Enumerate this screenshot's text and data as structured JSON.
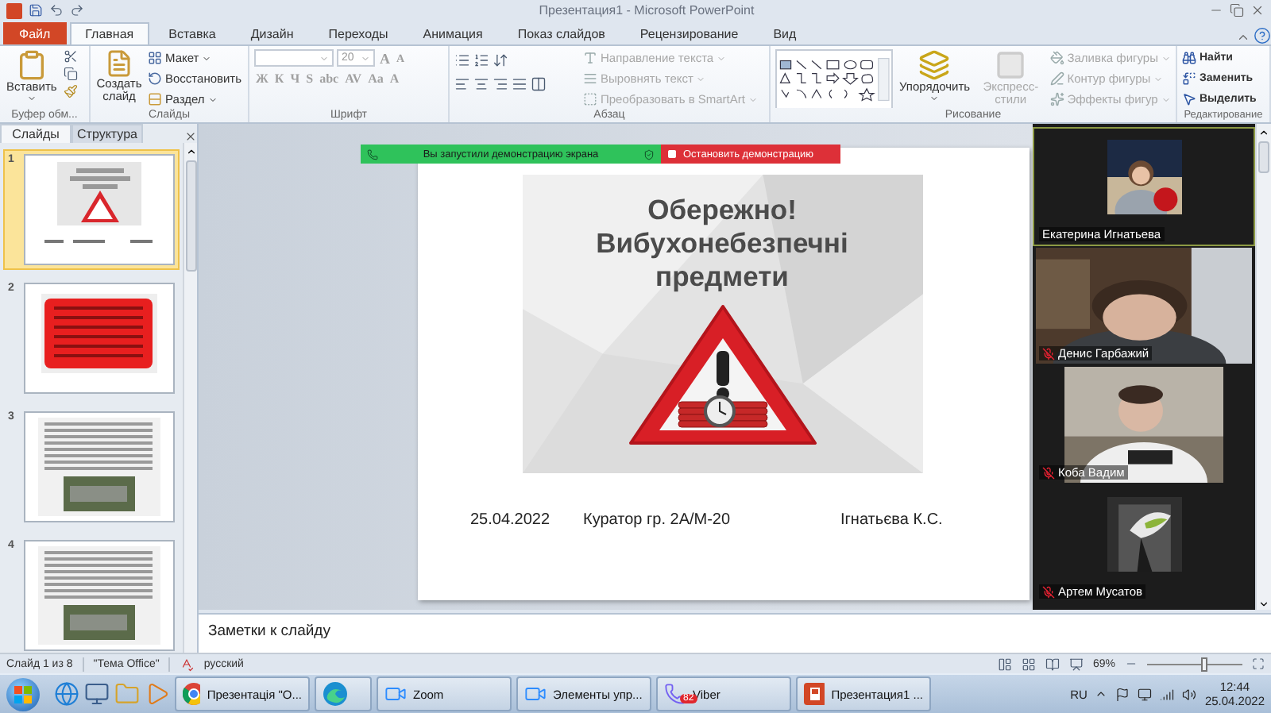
{
  "window": {
    "title": "Презентация1 - Microsoft PowerPoint"
  },
  "ribbon_tabs": [
    {
      "label": "Файл",
      "kind": "file",
      "selected": false
    },
    {
      "label": "Главная",
      "kind": "tab",
      "selected": true
    },
    {
      "label": "Вставка",
      "kind": "tab",
      "selected": false
    },
    {
      "label": "Дизайн",
      "kind": "tab",
      "selected": false
    },
    {
      "label": "Переходы",
      "kind": "tab",
      "selected": false
    },
    {
      "label": "Анимация",
      "kind": "tab",
      "selected": false
    },
    {
      "label": "Показ слайдов",
      "kind": "tab",
      "selected": false
    },
    {
      "label": "Рецензирование",
      "kind": "tab",
      "selected": false
    },
    {
      "label": "Вид",
      "kind": "tab",
      "selected": false
    }
  ],
  "clipboard_group": {
    "label": "Буфер обм...",
    "paste_button": "Вставить"
  },
  "slides_group": {
    "label": "Слайды",
    "new_slide_button": "Создать слайд",
    "commands": [
      {
        "label": "Макет"
      },
      {
        "label": "Восстановить"
      },
      {
        "label": "Раздел"
      }
    ]
  },
  "font_group": {
    "label": "Шрифт",
    "disabled": true,
    "size_field": {
      "value": "20"
    },
    "size_buttons": [
      "A",
      "A"
    ],
    "format_buttons": [
      "Ж",
      "К",
      "Ч",
      "S",
      "abc",
      "AV",
      "Aa",
      "A"
    ]
  },
  "paragraph_group": {
    "label": "Абзац",
    "commands": [
      {
        "label": "Направление текста",
        "disabled": true
      },
      {
        "label": "Выровнять текст",
        "disabled": true
      },
      {
        "label": "Преобразовать в SmartArt",
        "disabled": true
      }
    ]
  },
  "drawing_group": {
    "label": "Рисование",
    "arrange_button": {
      "label": "Упорядочить",
      "disabled": false
    },
    "quick_styles_button": {
      "label": "Экспресс-стили",
      "disabled": true
    },
    "commands": [
      {
        "label": "Заливка фигуры",
        "disabled": true
      },
      {
        "label": "Контур фигуры",
        "disabled": true
      },
      {
        "label": "Эффекты фигур",
        "disabled": true
      }
    ]
  },
  "editing_group": {
    "label": "Редактирование",
    "commands": [
      {
        "label": "Найти"
      },
      {
        "label": "Заменить"
      },
      {
        "label": "Выделить"
      }
    ]
  },
  "panel_tabs": [
    {
      "label": "Слайды",
      "selected": true
    },
    {
      "label": "Структура",
      "selected": false
    }
  ],
  "thumbnails": [
    {
      "number": "1",
      "selected": true,
      "kind": "title"
    },
    {
      "number": "2",
      "selected": false,
      "kind": "warning"
    },
    {
      "number": "3",
      "selected": false,
      "kind": "text_photo"
    },
    {
      "number": "4",
      "selected": false,
      "kind": "text_photo"
    }
  ],
  "share_bar": {
    "status": "Вы запустили демонстрацию экрана",
    "stop_button": "Остановить демонстрацию"
  },
  "slide": {
    "title": "Обережно!\nВибухонебезпечні\nпредмети",
    "date": "25.04.2022",
    "curator": "Куратор гр. 2А/М-20",
    "author": "Ігнатьєва К.С."
  },
  "participants": [
    {
      "name": "Екатерина Игнатьева",
      "muted": false,
      "highlighted": true
    },
    {
      "name": "Денис Гарбажий",
      "muted": true,
      "highlighted": false,
      "kind": "video"
    },
    {
      "name": "Коба Вадим",
      "muted": true,
      "highlighted": false,
      "kind": "video"
    },
    {
      "name": "Артем Мусатов",
      "muted": true,
      "highlighted": false
    }
  ],
  "notes": {
    "placeholder": "Заметки к слайду"
  },
  "status_bar": {
    "slide_position": "Слайд 1 из 8",
    "theme": "\"Тема Office\"",
    "language": "русский",
    "zoom": "69%",
    "zoom_slider": {
      "level": 0.6
    }
  },
  "taskbar": {
    "tasks": [
      {
        "label": "Презентація \"О...",
        "kind": "chrome"
      },
      {
        "kind": "edge"
      },
      {
        "label": "Zoom",
        "kind": "zoom"
      },
      {
        "label": "Элементы упр...",
        "kind": "zoom"
      },
      {
        "label": "Viber",
        "kind": "viber",
        "badge": "82"
      },
      {
        "label": "Презентация1 ...",
        "kind": "powerpoint"
      }
    ],
    "language": "RU",
    "time": "12:44",
    "date": "25.04.2022"
  }
}
